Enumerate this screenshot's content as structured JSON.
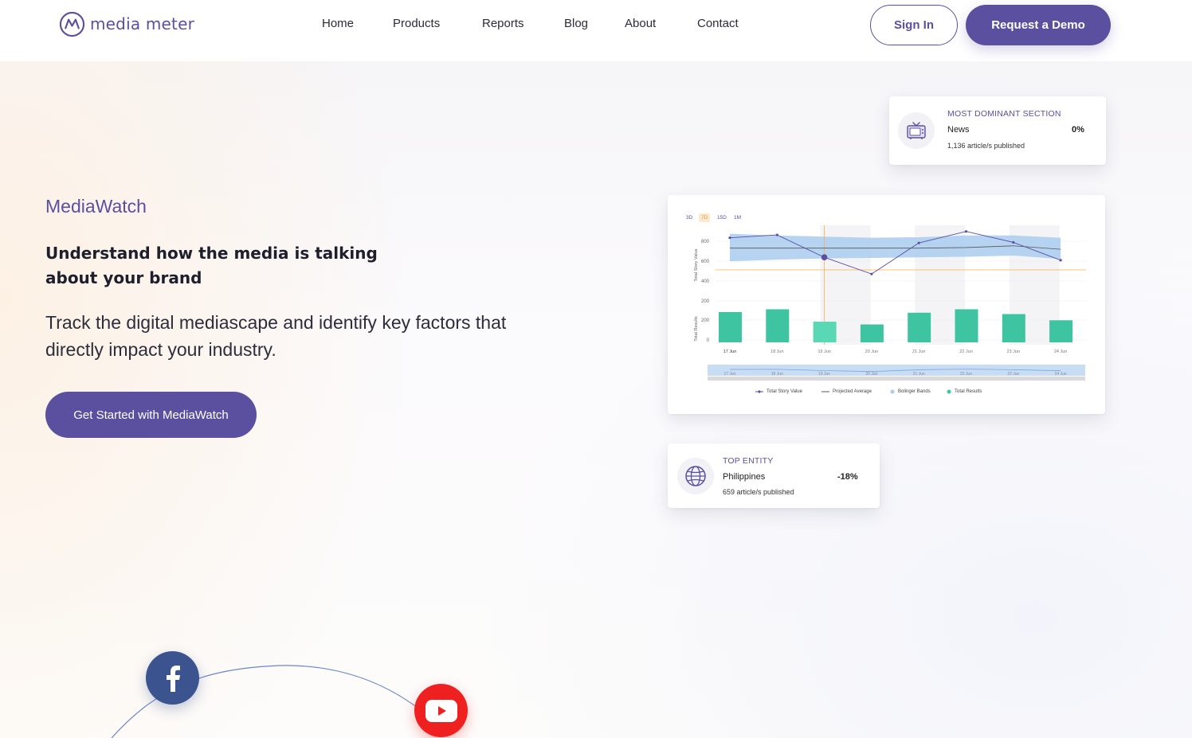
{
  "brand": {
    "logo_text": "media meter",
    "accent": "#5b4fa0"
  },
  "nav": {
    "items": [
      {
        "label": "Home"
      },
      {
        "label": "Products"
      },
      {
        "label": "Reports"
      },
      {
        "label": "Blog"
      },
      {
        "label": "About"
      },
      {
        "label": "Contact"
      }
    ],
    "sign_in": "Sign In",
    "request_demo": "Request a Demo"
  },
  "hero": {
    "eyebrow": "MediaWatch",
    "headline": "Understand how the media is talking about your brand",
    "subline": "Track the digital mediascape and identify key factors that directly impact your industry.",
    "cta": "Get Started with MediaWatch"
  },
  "dominant_card": {
    "title": "MOST DOMINANT SECTION",
    "name": "News",
    "pct": "0%",
    "sub": "1,136 article/s published",
    "icon": "tv-icon"
  },
  "entity_card": {
    "title": "TOP ENTITY",
    "name": "Philippines",
    "pct": "-18%",
    "sub": "659 article/s published",
    "icon": "globe-icon"
  },
  "range_tabs": [
    "3D",
    "7D",
    "15D",
    "1M"
  ],
  "range_selected": "7D",
  "chart_data": {
    "type": "line",
    "categories": [
      "17 Jun",
      "18 Jun",
      "19 Jun",
      "20 Jun",
      "21 Jun",
      "22 Jun",
      "23 Jun",
      "24 Jun"
    ],
    "series": [
      {
        "name": "Total Story Value",
        "type": "line",
        "values": [
          790,
          815,
          620,
          475,
          745,
          845,
          750,
          595
        ]
      },
      {
        "name": "Projected Average",
        "type": "line",
        "values": [
          700,
          700,
          700,
          700,
          700,
          705,
          720,
          690
        ]
      },
      {
        "name": "Total Results",
        "type": "bar",
        "values": [
          220,
          240,
          150,
          130,
          215,
          240,
          205,
          160
        ]
      }
    ],
    "bollinger_bands": {
      "upper": [
        825,
        810,
        800,
        790,
        795,
        810,
        810,
        790
      ],
      "lower": [
        585,
        600,
        610,
        615,
        620,
        625,
        635,
        605
      ]
    },
    "top_y_ticks": [
      "800",
      "600",
      "400",
      "200"
    ],
    "bottom_y_ticks": [
      "200",
      "0"
    ],
    "top_ylabel": "Total Story Value",
    "bottom_ylabel": "Total Results",
    "legend": [
      "Total Story Value",
      "Projected Average",
      "Bolinger Bands",
      "Total Results"
    ],
    "colors": {
      "line": "#5b4fa0",
      "band": "#a9cdf0",
      "bar": "#3ec4a0",
      "bar_highlight": "#5ad8b5",
      "marker": "#f4b24d"
    }
  },
  "social": {
    "facebook": "facebook-icon",
    "youtube": "youtube-icon"
  }
}
